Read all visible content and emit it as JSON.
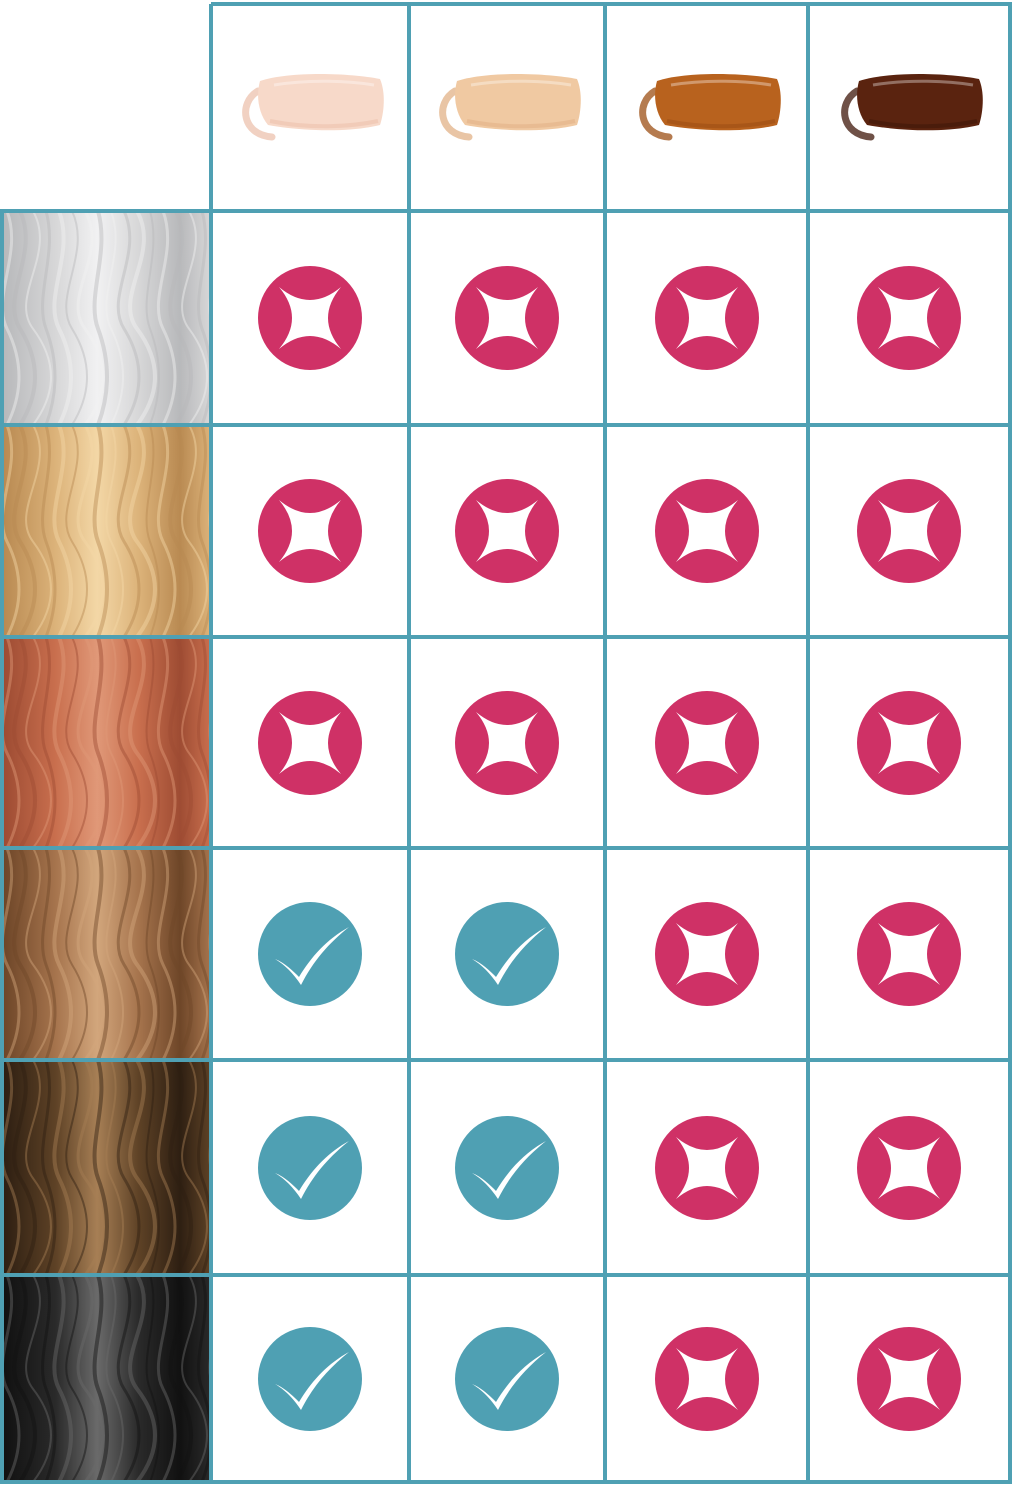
{
  "colors": {
    "grid_line": "#4fa0b3",
    "yes": "#4fa0b3",
    "no": "#cf3166",
    "symbol": "#ffffff"
  },
  "skin_tones": [
    {
      "name": "fair",
      "color": "#f7d9c9",
      "shade": "#ecc2ad"
    },
    {
      "name": "light",
      "color": "#f0c9a2",
      "shade": "#e2b287"
    },
    {
      "name": "medium",
      "color": "#b8621e",
      "shade": "#9c4f14"
    },
    {
      "name": "deep",
      "color": "#5a230f",
      "shade": "#3f1709"
    }
  ],
  "hair_colors": [
    {
      "name": "platinum-white",
      "base": "#d7d7d8",
      "light": "#f1f1f2",
      "dark": "#b8b9bb"
    },
    {
      "name": "golden-blonde",
      "base": "#dcb37a",
      "light": "#f3d7a6",
      "dark": "#b98a52"
    },
    {
      "name": "copper-red",
      "base": "#c96f4e",
      "light": "#e09878",
      "dark": "#9e4c33"
    },
    {
      "name": "light-brown",
      "base": "#a6744d",
      "light": "#d2a67c",
      "dark": "#6e4628"
    },
    {
      "name": "dark-brown",
      "base": "#5e4226",
      "light": "#a77f55",
      "dark": "#2e1f12"
    },
    {
      "name": "black",
      "base": "#2a2a2a",
      "light": "#6a6a6a",
      "dark": "#111111"
    }
  ],
  "matrix": [
    [
      "no",
      "no",
      "no",
      "no"
    ],
    [
      "no",
      "no",
      "no",
      "no"
    ],
    [
      "no",
      "no",
      "no",
      "no"
    ],
    [
      "yes",
      "yes",
      "no",
      "no"
    ],
    [
      "yes",
      "yes",
      "no",
      "no"
    ],
    [
      "yes",
      "yes",
      "no",
      "no"
    ]
  ]
}
